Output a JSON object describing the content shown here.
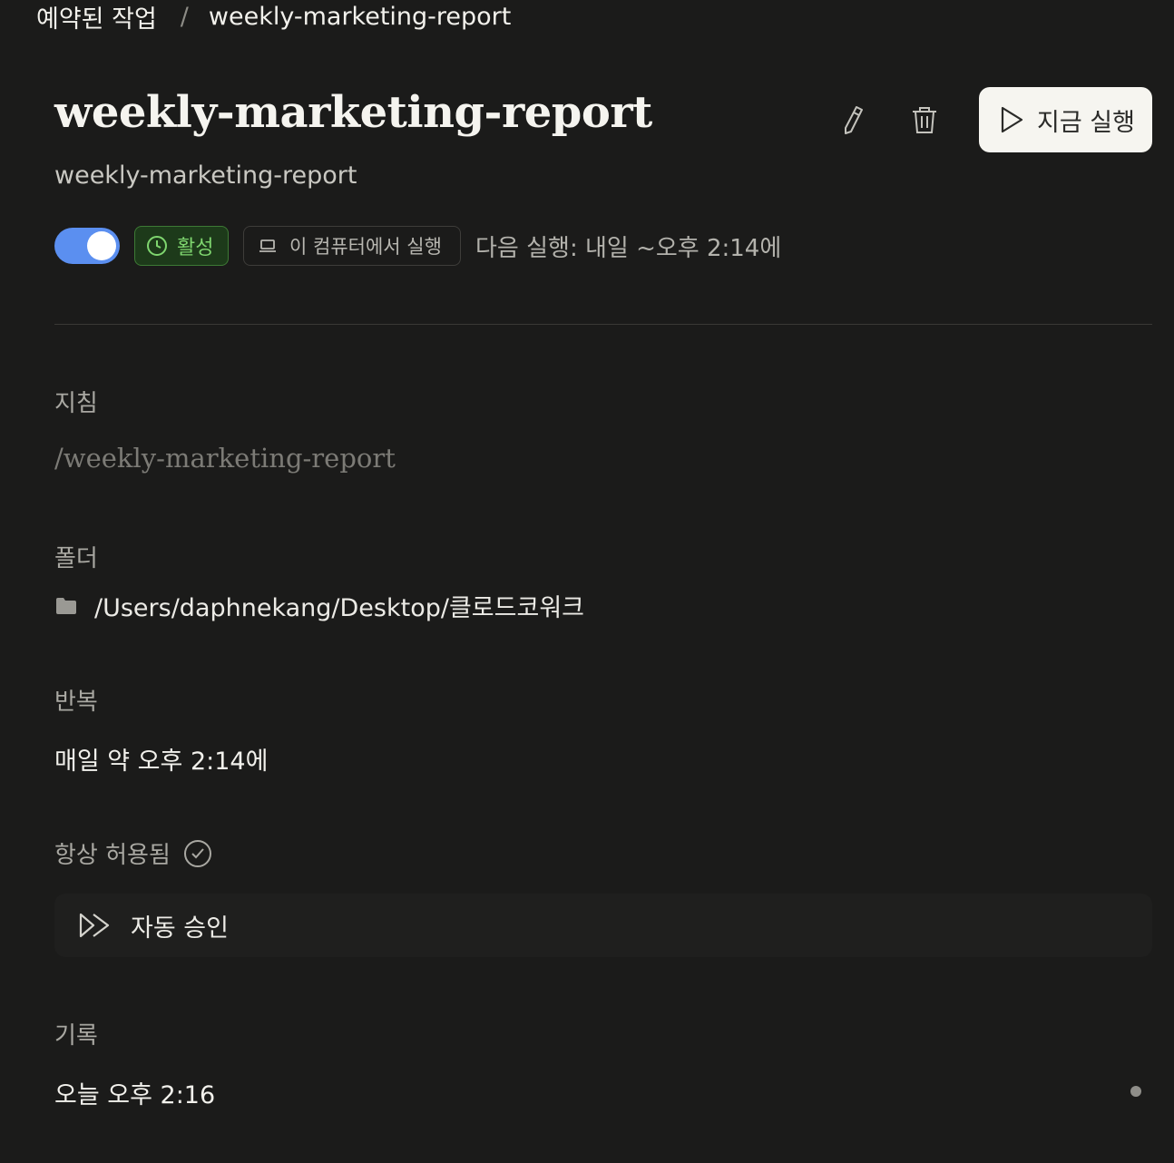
{
  "breadcrumb": {
    "parent": "예약된 작업",
    "separator": "/",
    "current": "weekly-marketing-report"
  },
  "header": {
    "title": "weekly-marketing-report",
    "subtitle": "weekly-marketing-report",
    "run_now_label": "지금 실행"
  },
  "status": {
    "enabled": true,
    "active_label": "활성",
    "location_label": "이 컴퓨터에서 실행",
    "next_run": "다음 실행: 내일 ~오후 2:14에"
  },
  "instructions": {
    "label": "지침",
    "value": "/weekly-marketing-report"
  },
  "folder": {
    "label": "폴더",
    "path": "/Users/daphnekang/Desktop/클로드코워크"
  },
  "repeat": {
    "label": "반복",
    "value": "매일 약 오후 2:14에"
  },
  "permissions": {
    "label": "항상 허용됨",
    "item_label": "자동 승인"
  },
  "history": {
    "label": "기록",
    "entries": [
      {
        "time": "오늘 오후 2:16"
      }
    ]
  },
  "colors": {
    "toggle_on": "#5b8ff0",
    "active_badge_text": "#7fd66f",
    "background": "#1b1b1a"
  }
}
